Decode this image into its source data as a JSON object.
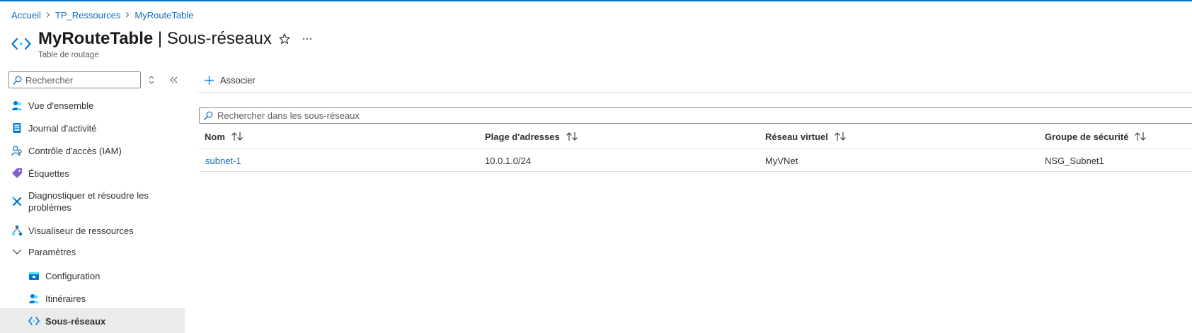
{
  "breadcrumb": {
    "items": [
      "Accueil",
      "TP_Ressources",
      "MyRouteTable"
    ]
  },
  "header": {
    "resource_name": "MyRouteTable",
    "separator": "|",
    "page_name": "Sous-réseaux",
    "resource_type": "Table de routage",
    "icons": {
      "resource": "subnet-icon",
      "favorite": "star-icon",
      "more": "ellipsis-icon"
    }
  },
  "sidebar": {
    "search_placeholder": "Rechercher",
    "items": [
      {
        "label": "Vue d'ensemble",
        "icon": "overview-icon"
      },
      {
        "label": "Journal d'activité",
        "icon": "activity-log-icon"
      },
      {
        "label": "Contrôle d'accès (IAM)",
        "icon": "iam-icon"
      },
      {
        "label": "Étiquettes",
        "icon": "tag-icon"
      },
      {
        "label": "Diagnostiquer et résoudre les problèmes",
        "icon": "wrench-icon"
      },
      {
        "label": "Visualiseur de ressources",
        "icon": "resource-visualizer-icon"
      }
    ],
    "section": {
      "label": "Paramètres",
      "expanded": true
    },
    "sub_items": [
      {
        "label": "Configuration",
        "icon": "configuration-icon"
      },
      {
        "label": "Itinéraires",
        "icon": "routes-icon"
      },
      {
        "label": "Sous-réseaux",
        "icon": "subnet-icon",
        "selected": true
      }
    ]
  },
  "toolbar": {
    "associate_label": "Associer"
  },
  "table": {
    "search_placeholder": "Rechercher dans les sous-réseaux",
    "columns": [
      "Nom",
      "Plage d'adresses",
      "Réseau virtuel",
      "Groupe de sécurité"
    ],
    "rows": [
      [
        "subnet-1",
        "10.0.1.0/24",
        "MyVNet",
        "NSG_Subnet1"
      ]
    ]
  },
  "colors": {
    "accent": "#0078d4",
    "link": "#0f6cbd",
    "selected_background": "#ebebeb"
  }
}
